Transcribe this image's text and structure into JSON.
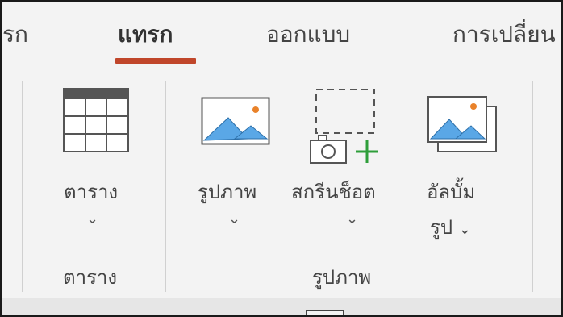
{
  "tabs": [
    {
      "label": "รก"
    },
    {
      "label": "แทรก",
      "active": true
    },
    {
      "label": "ออกแบบ"
    },
    {
      "label": "การเปลี่ยน"
    }
  ],
  "accent_color": "#c0462a",
  "groups": {
    "table": {
      "label": "ตาราง",
      "button": {
        "label": "ตาราง",
        "icon": "table-icon"
      }
    },
    "images": {
      "label": "รูปภาพ",
      "buttons": [
        {
          "label": "รูปภาพ",
          "icon": "picture-icon"
        },
        {
          "label": "สกรีนช็อต",
          "icon": "screenshot-icon"
        },
        {
          "label_line1": "อัลบั้ม",
          "label_line2": "รูป",
          "icon": "photo-album-icon"
        }
      ]
    }
  }
}
